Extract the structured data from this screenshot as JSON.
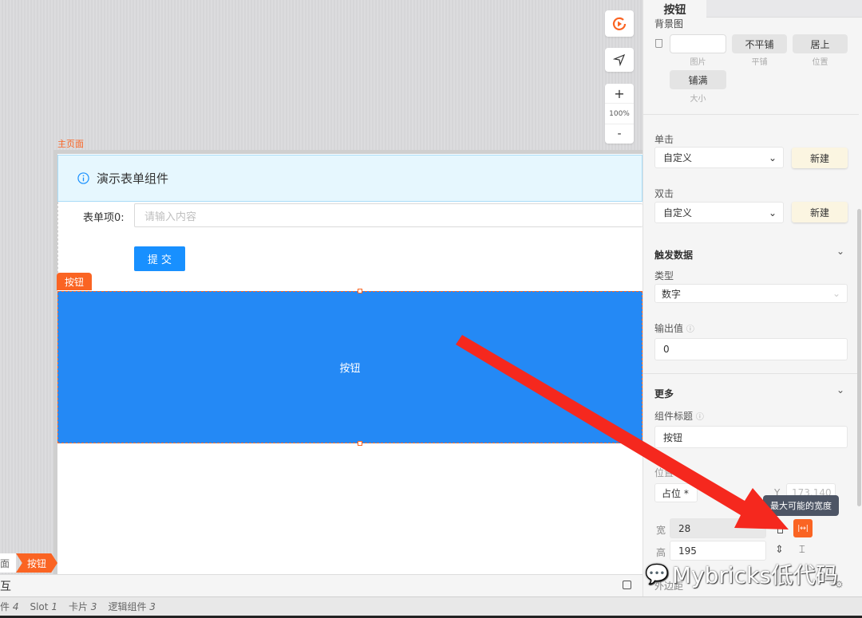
{
  "canvas": {
    "page_label": "主页面",
    "zoom": "100%",
    "zoom_in": "+",
    "zoom_out": "-",
    "alert_text": "演示表单组件",
    "form_label": "表单项0:",
    "form_placeholder": "请输入内容",
    "submit_label": "提 交",
    "selected_tag": "按钮",
    "big_button_label": "按钮"
  },
  "breadcrumb": {
    "items": [
      "面",
      "按钮"
    ]
  },
  "bottom": {
    "title": "互",
    "stats": [
      {
        "label": "件",
        "count": "4"
      },
      {
        "label": "Slot",
        "count": "1"
      },
      {
        "label": "卡片",
        "count": "3"
      },
      {
        "label": "逻辑组件",
        "count": "3"
      }
    ]
  },
  "panel": {
    "tab": "按钮",
    "bg": {
      "title": "背景图",
      "image_label": "图片",
      "repeat_value": "不平铺",
      "repeat_label": "平铺",
      "position_value": "居上",
      "position_label": "位置",
      "size_value": "铺满",
      "size_label": "大小"
    },
    "click": {
      "title": "单击",
      "value": "自定义",
      "new": "新建"
    },
    "dblclick": {
      "title": "双击",
      "value": "自定义",
      "new": "新建"
    },
    "trigger": {
      "title": "触发数据",
      "type_label": "类型",
      "type_value": "数字",
      "output_label": "输出值",
      "output_value": "0"
    },
    "more": {
      "title": "更多",
      "comp_title_label": "组件标题",
      "comp_title_value": "按钮",
      "position_label": "位置",
      "position_value": "占位 *",
      "y_label": "Y",
      "y_value": "173.140",
      "tooltip": "最大可能的宽度",
      "width_label": "宽",
      "width_value": "28",
      "height_label": "高",
      "height_value": "195",
      "margin_label": "外边距"
    }
  },
  "watermark": "Mybricks低代码",
  "colors": {
    "accent": "#fa6423",
    "primary": "#1890ff",
    "big_button": "#2489f5",
    "alert_bg": "#e6f7fe",
    "arrow": "#f5281e"
  }
}
